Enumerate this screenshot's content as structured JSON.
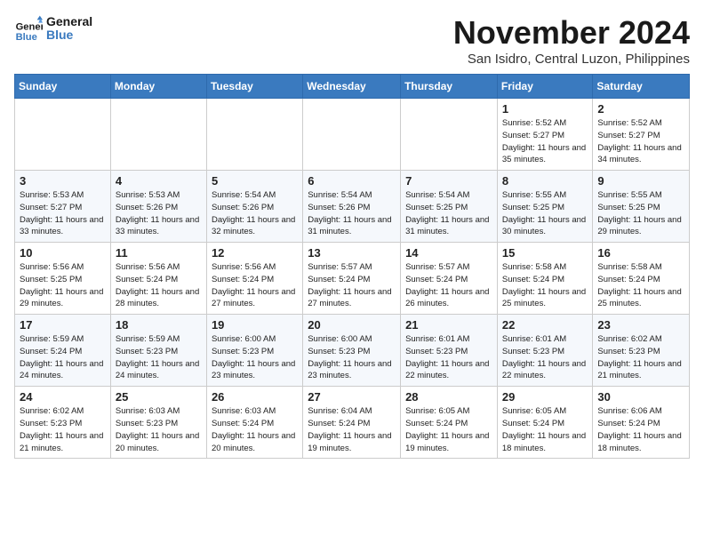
{
  "logo": {
    "line1": "General",
    "line2": "Blue"
  },
  "title": "November 2024",
  "subtitle": "San Isidro, Central Luzon, Philippines",
  "weekdays": [
    "Sunday",
    "Monday",
    "Tuesday",
    "Wednesday",
    "Thursday",
    "Friday",
    "Saturday"
  ],
  "weeks": [
    [
      {
        "day": "",
        "info": ""
      },
      {
        "day": "",
        "info": ""
      },
      {
        "day": "",
        "info": ""
      },
      {
        "day": "",
        "info": ""
      },
      {
        "day": "",
        "info": ""
      },
      {
        "day": "1",
        "info": "Sunrise: 5:52 AM\nSunset: 5:27 PM\nDaylight: 11 hours\nand 35 minutes."
      },
      {
        "day": "2",
        "info": "Sunrise: 5:52 AM\nSunset: 5:27 PM\nDaylight: 11 hours\nand 34 minutes."
      }
    ],
    [
      {
        "day": "3",
        "info": "Sunrise: 5:53 AM\nSunset: 5:27 PM\nDaylight: 11 hours\nand 33 minutes."
      },
      {
        "day": "4",
        "info": "Sunrise: 5:53 AM\nSunset: 5:26 PM\nDaylight: 11 hours\nand 33 minutes."
      },
      {
        "day": "5",
        "info": "Sunrise: 5:54 AM\nSunset: 5:26 PM\nDaylight: 11 hours\nand 32 minutes."
      },
      {
        "day": "6",
        "info": "Sunrise: 5:54 AM\nSunset: 5:26 PM\nDaylight: 11 hours\nand 31 minutes."
      },
      {
        "day": "7",
        "info": "Sunrise: 5:54 AM\nSunset: 5:25 PM\nDaylight: 11 hours\nand 31 minutes."
      },
      {
        "day": "8",
        "info": "Sunrise: 5:55 AM\nSunset: 5:25 PM\nDaylight: 11 hours\nand 30 minutes."
      },
      {
        "day": "9",
        "info": "Sunrise: 5:55 AM\nSunset: 5:25 PM\nDaylight: 11 hours\nand 29 minutes."
      }
    ],
    [
      {
        "day": "10",
        "info": "Sunrise: 5:56 AM\nSunset: 5:25 PM\nDaylight: 11 hours\nand 29 minutes."
      },
      {
        "day": "11",
        "info": "Sunrise: 5:56 AM\nSunset: 5:24 PM\nDaylight: 11 hours\nand 28 minutes."
      },
      {
        "day": "12",
        "info": "Sunrise: 5:56 AM\nSunset: 5:24 PM\nDaylight: 11 hours\nand 27 minutes."
      },
      {
        "day": "13",
        "info": "Sunrise: 5:57 AM\nSunset: 5:24 PM\nDaylight: 11 hours\nand 27 minutes."
      },
      {
        "day": "14",
        "info": "Sunrise: 5:57 AM\nSunset: 5:24 PM\nDaylight: 11 hours\nand 26 minutes."
      },
      {
        "day": "15",
        "info": "Sunrise: 5:58 AM\nSunset: 5:24 PM\nDaylight: 11 hours\nand 25 minutes."
      },
      {
        "day": "16",
        "info": "Sunrise: 5:58 AM\nSunset: 5:24 PM\nDaylight: 11 hours\nand 25 minutes."
      }
    ],
    [
      {
        "day": "17",
        "info": "Sunrise: 5:59 AM\nSunset: 5:24 PM\nDaylight: 11 hours\nand 24 minutes."
      },
      {
        "day": "18",
        "info": "Sunrise: 5:59 AM\nSunset: 5:23 PM\nDaylight: 11 hours\nand 24 minutes."
      },
      {
        "day": "19",
        "info": "Sunrise: 6:00 AM\nSunset: 5:23 PM\nDaylight: 11 hours\nand 23 minutes."
      },
      {
        "day": "20",
        "info": "Sunrise: 6:00 AM\nSunset: 5:23 PM\nDaylight: 11 hours\nand 23 minutes."
      },
      {
        "day": "21",
        "info": "Sunrise: 6:01 AM\nSunset: 5:23 PM\nDaylight: 11 hours\nand 22 minutes."
      },
      {
        "day": "22",
        "info": "Sunrise: 6:01 AM\nSunset: 5:23 PM\nDaylight: 11 hours\nand 22 minutes."
      },
      {
        "day": "23",
        "info": "Sunrise: 6:02 AM\nSunset: 5:23 PM\nDaylight: 11 hours\nand 21 minutes."
      }
    ],
    [
      {
        "day": "24",
        "info": "Sunrise: 6:02 AM\nSunset: 5:23 PM\nDaylight: 11 hours\nand 21 minutes."
      },
      {
        "day": "25",
        "info": "Sunrise: 6:03 AM\nSunset: 5:23 PM\nDaylight: 11 hours\nand 20 minutes."
      },
      {
        "day": "26",
        "info": "Sunrise: 6:03 AM\nSunset: 5:24 PM\nDaylight: 11 hours\nand 20 minutes."
      },
      {
        "day": "27",
        "info": "Sunrise: 6:04 AM\nSunset: 5:24 PM\nDaylight: 11 hours\nand 19 minutes."
      },
      {
        "day": "28",
        "info": "Sunrise: 6:05 AM\nSunset: 5:24 PM\nDaylight: 11 hours\nand 19 minutes."
      },
      {
        "day": "29",
        "info": "Sunrise: 6:05 AM\nSunset: 5:24 PM\nDaylight: 11 hours\nand 18 minutes."
      },
      {
        "day": "30",
        "info": "Sunrise: 6:06 AM\nSunset: 5:24 PM\nDaylight: 11 hours\nand 18 minutes."
      }
    ]
  ]
}
